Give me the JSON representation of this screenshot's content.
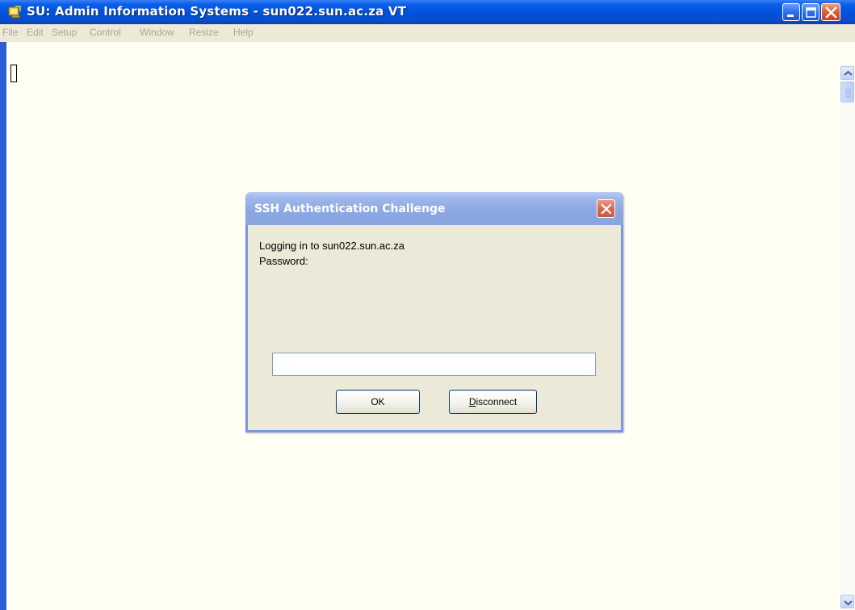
{
  "window": {
    "title": "SU: Admin Information Systems - sun022.sun.ac.za VT"
  },
  "menu": {
    "items": [
      "File",
      "Edit",
      "Setup",
      "Control",
      "Window",
      "Resize",
      "Help"
    ]
  },
  "dialog": {
    "title": "SSH Authentication Challenge",
    "message_line1": "Logging in to sun022.sun.ac.za",
    "message_line2": "Password:",
    "password_value": "",
    "ok_label": "OK",
    "disconnect_label": "Disconnect"
  },
  "colors": {
    "titlebar": "#0052dc",
    "terminal_bg": "#fffff4",
    "dialog_bg": "#ece9d8",
    "dialog_title": "#8ba7e3"
  },
  "icons": {
    "app": "terminal-app-icon",
    "minimize": "minimize-icon",
    "maximize": "maximize-icon",
    "close": "close-icon",
    "dialog_close": "close-icon",
    "scroll_up": "chevron-up-icon",
    "scroll_down": "chevron-down-icon"
  }
}
